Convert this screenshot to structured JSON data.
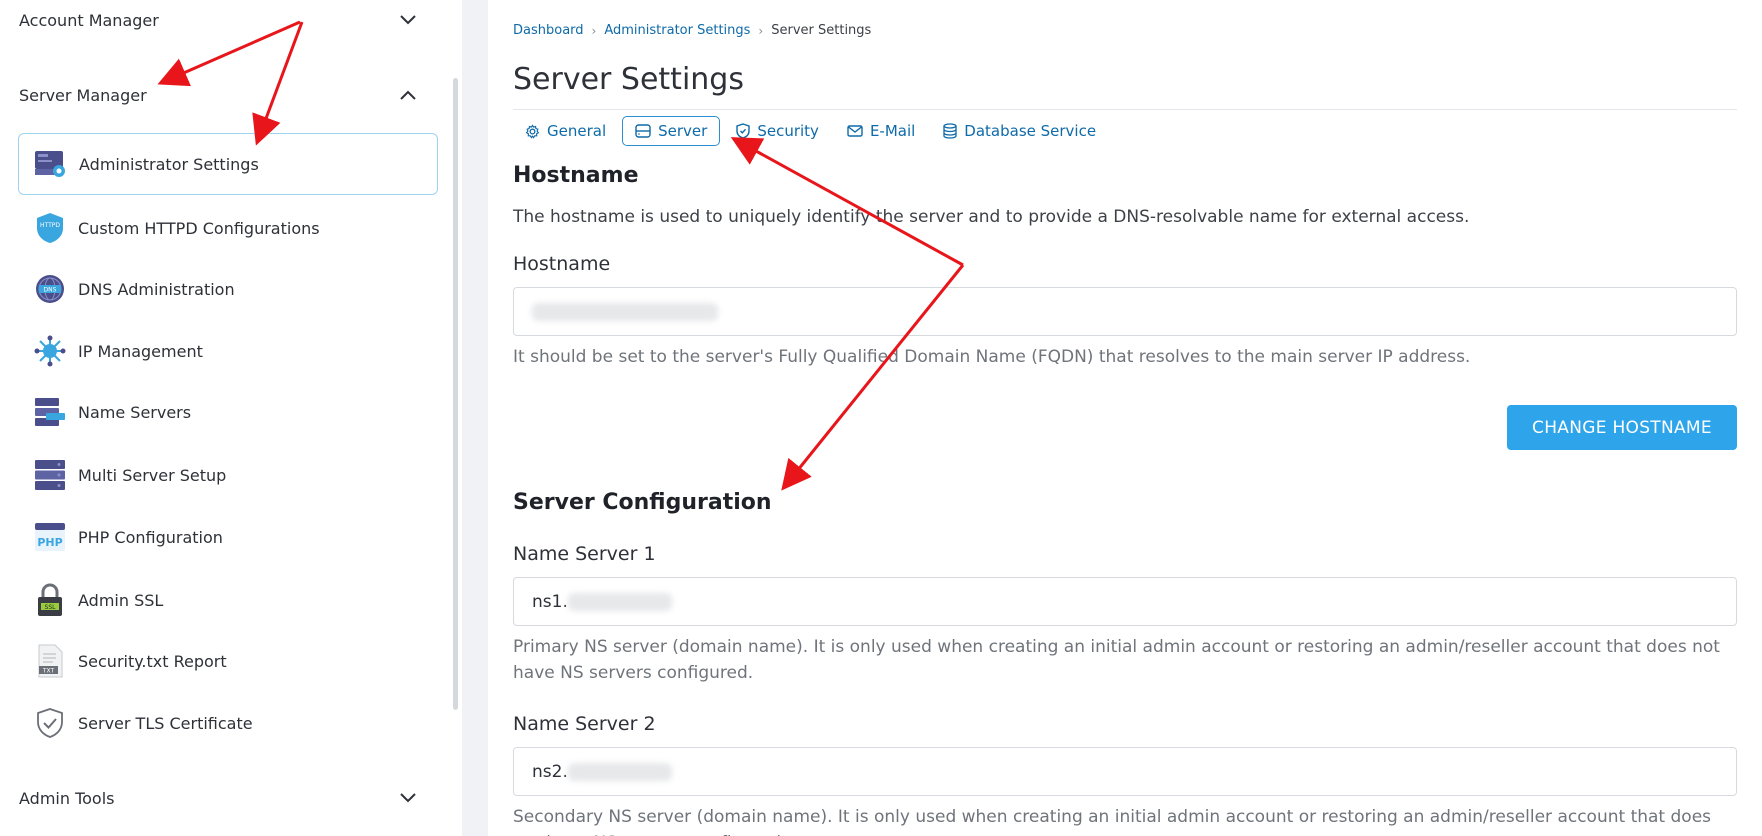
{
  "sidebar": {
    "sections": {
      "account_manager": "Account Manager",
      "server_manager": "Server Manager",
      "admin_tools": "Admin Tools"
    },
    "items": [
      {
        "label": "Administrator Settings",
        "icon": "admin-settings-icon"
      },
      {
        "label": "Custom HTTPD Configurations",
        "icon": "httpd-shield-icon"
      },
      {
        "label": "DNS Administration",
        "icon": "dns-globe-icon"
      },
      {
        "label": "IP Management",
        "icon": "ip-network-icon"
      },
      {
        "label": "Name Servers",
        "icon": "name-servers-icon"
      },
      {
        "label": "Multi Server Setup",
        "icon": "server-stack-icon"
      },
      {
        "label": "PHP Configuration",
        "icon": "php-icon"
      },
      {
        "label": "Admin SSL",
        "icon": "ssl-lock-icon"
      },
      {
        "label": "Security.txt Report",
        "icon": "txt-file-icon"
      },
      {
        "label": "Server TLS Certificate",
        "icon": "shield-check-icon"
      }
    ],
    "icon_labels": {
      "httpd": "HTTPD",
      "dns": "DNS",
      "php": "PHP",
      "ssl": "SSL",
      "txt": "TXT"
    }
  },
  "breadcrumb": {
    "items": [
      "Dashboard",
      "Administrator Settings"
    ],
    "current": "Server Settings"
  },
  "page": {
    "title": "Server Settings"
  },
  "tabs": [
    {
      "label": "General",
      "icon": "gear-icon"
    },
    {
      "label": "Server",
      "icon": "server-icon",
      "active": true
    },
    {
      "label": "Security",
      "icon": "shield-icon"
    },
    {
      "label": "E-Mail",
      "icon": "mail-icon"
    },
    {
      "label": "Database Service",
      "icon": "database-icon"
    }
  ],
  "hostname_section": {
    "heading": "Hostname",
    "description": "The hostname is used to uniquely identify the server and to provide a DNS-resolvable name for external access.",
    "field_label": "Hostname",
    "help": "It should be set to the server's Fully Qualified Domain Name (FQDN) that resolves to the main server IP address.",
    "button": "CHANGE HOSTNAME"
  },
  "server_config": {
    "heading": "Server Configuration",
    "ns1": {
      "label": "Name Server 1",
      "value_prefix": "ns1.",
      "help": "Primary NS server (domain name). It is only used when creating an initial admin account or restoring an admin/reseller account that does not have NS servers configured."
    },
    "ns2": {
      "label": "Name Server 2",
      "value_prefix": "ns2.",
      "help": "Secondary NS server (domain name). It is only used when creating an initial admin account or restoring an admin/reseller account that does not have NS servers configured."
    }
  },
  "colors": {
    "accent": "#0e6aa8",
    "primary_button": "#2ea4ea",
    "active_border": "#9fd4ef",
    "annotation_arrow": "#e8161b"
  }
}
